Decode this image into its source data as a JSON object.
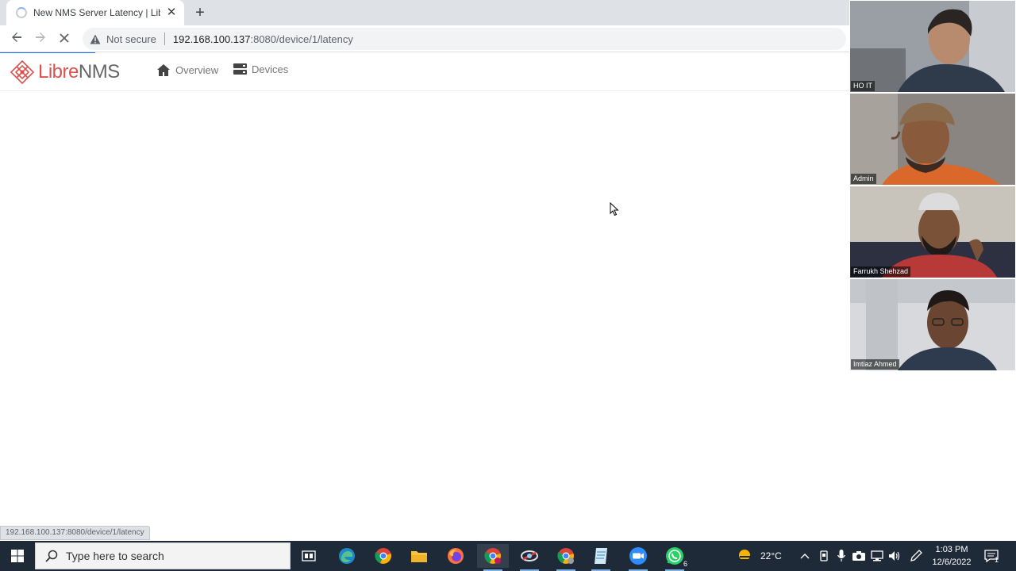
{
  "browser": {
    "tab_title": "New NMS Server Latency | Libre",
    "tab_close": "✕",
    "new_tab": "+",
    "security_label": "Not secure",
    "url_host": "192.168.100.137",
    "url_rest": ":8080/device/1/latency",
    "status_url": "192.168.100.137:8080/device/1/latency"
  },
  "app": {
    "logo_libre": "Libre",
    "logo_nms": "NMS",
    "nav": [
      {
        "label": "Overview",
        "icon": "home-icon"
      },
      {
        "label": "Devices",
        "icon": "server-icon"
      }
    ]
  },
  "meeting": {
    "participants": [
      {
        "name": "HO IT",
        "bg": "#5b5f64"
      },
      {
        "name": "Admin",
        "bg": "#7a4a2c"
      },
      {
        "name": "Farrukh Shehzad",
        "bg": "#5a5752"
      },
      {
        "name": "Imtiaz Ahmed",
        "bg": "#4a4f56"
      }
    ]
  },
  "taskbar": {
    "search_placeholder": "Type here to search",
    "apps": [
      {
        "name": "task-view-icon"
      },
      {
        "name": "edge-icon"
      },
      {
        "name": "chrome-icon"
      },
      {
        "name": "file-explorer-icon"
      },
      {
        "name": "firefox-icon"
      },
      {
        "name": "chrome-profile-icon"
      },
      {
        "name": "network-tool-icon"
      },
      {
        "name": "chrome-profile-2-icon"
      },
      {
        "name": "notepad-icon"
      },
      {
        "name": "zoom-icon"
      },
      {
        "name": "whatsapp-icon",
        "badge": "6"
      }
    ],
    "weather_temp": "22°C",
    "time": "1:03 PM",
    "date": "12/6/2022",
    "notifications": "1"
  },
  "colors": {
    "brand_red": "#d9534f",
    "taskbar_bg": "#1f2a38",
    "chrome_tab_bg": "#dee1e6"
  }
}
